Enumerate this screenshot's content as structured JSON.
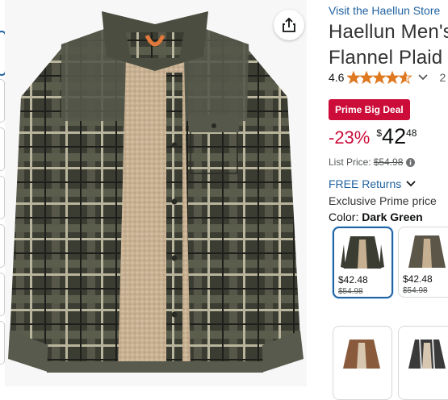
{
  "product": {
    "store_link": "Visit the Haellun Store",
    "title_line1": "Haellun Men's",
    "title_line2": "Flannel Plaid",
    "rating_value": "4.6",
    "rating_stars": 4.6,
    "rating_count_partial": "2",
    "deal_badge": "Prime Big Deal",
    "discount": "-23%",
    "currency": "$",
    "price_whole": "42",
    "price_fraction": "48",
    "list_price_label": "List Price:",
    "list_price": "$54.98",
    "returns": "FREE Returns",
    "prime_price": "Exclusive Prime price",
    "color_label": "Color:",
    "color_value": "Dark Green"
  },
  "swatches": [
    {
      "price": "$42.48",
      "old_price": "$54.98",
      "color": "dark-green",
      "selected": true
    },
    {
      "price": "$42.48",
      "old_price": "$54.98",
      "color": "khaki-black",
      "selected": false
    },
    {
      "price": "",
      "old_price": "",
      "color": "brown",
      "selected": false
    },
    {
      "price": "",
      "old_price": "",
      "color": "black-white",
      "selected": false
    }
  ],
  "colors": {
    "link": "#2162a1",
    "deal_red": "#cc0c39",
    "star": "#de7921"
  },
  "icons": [
    "share-icon",
    "star-icon",
    "chevron-down-icon",
    "info-icon"
  ]
}
